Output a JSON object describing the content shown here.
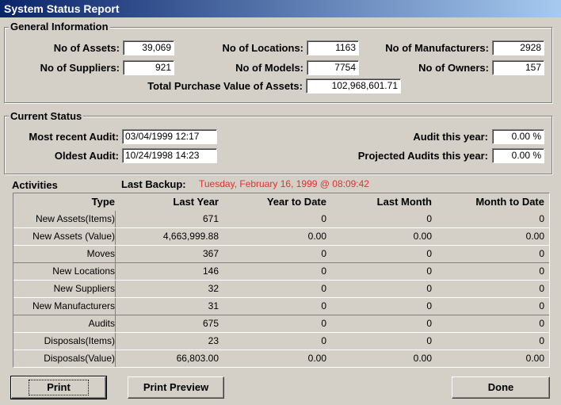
{
  "window": {
    "title": "System Status Report"
  },
  "general": {
    "title": "General Information",
    "assets_label": "No of Assets:",
    "assets_value": "39,069",
    "locations_label": "No of Locations:",
    "locations_value": "1163",
    "manufacturers_label": "No of Manufacturers:",
    "manufacturers_value": "2928",
    "suppliers_label": "No of Suppliers:",
    "suppliers_value": "921",
    "models_label": "No of Models:",
    "models_value": "7754",
    "owners_label": "No of Owners:",
    "owners_value": "157",
    "purchase_label": "Total Purchase Value of Assets:",
    "purchase_value": "102,968,601.71"
  },
  "status": {
    "title": "Current Status",
    "recent_label": "Most recent Audit:",
    "recent_value": "03/04/1999 12:17",
    "oldest_label": "Oldest Audit:",
    "oldest_value": "10/24/1998 14:23",
    "audit_year_label": "Audit this year:",
    "audit_year_value": "0.00 %",
    "projected_label": "Projected Audits this year:",
    "projected_value": "0.00 %"
  },
  "activities": {
    "title": "Activities",
    "backup_label": "Last Backup:",
    "backup_value": "Tuesday, February 16, 1999 @ 08:09:42",
    "backup_color": "#e03030",
    "headers": [
      "Type",
      "Last Year",
      "Year to Date",
      "Last Month",
      "Month to Date"
    ],
    "rows": [
      [
        "New Assets(Items)",
        "671",
        "0",
        "0",
        "0"
      ],
      [
        "New Assets (Value)",
        "4,663,999.88",
        "0.00",
        "0.00",
        "0.00"
      ],
      [
        "Moves",
        "367",
        "0",
        "0",
        "0"
      ],
      [
        "New Locations",
        "146",
        "0",
        "0",
        "0"
      ],
      [
        "New Suppliers",
        "32",
        "0",
        "0",
        "0"
      ],
      [
        "New Manufacturers",
        "31",
        "0",
        "0",
        "0"
      ],
      [
        "Audits",
        "675",
        "0",
        "0",
        "0"
      ],
      [
        "Disposals(Items)",
        "23",
        "0",
        "0",
        "0"
      ],
      [
        "Disposals(Value)",
        "66,803.00",
        "0.00",
        "0.00",
        "0.00"
      ]
    ]
  },
  "buttons": {
    "print": "Print",
    "preview": "Print Preview",
    "done": "Done"
  }
}
